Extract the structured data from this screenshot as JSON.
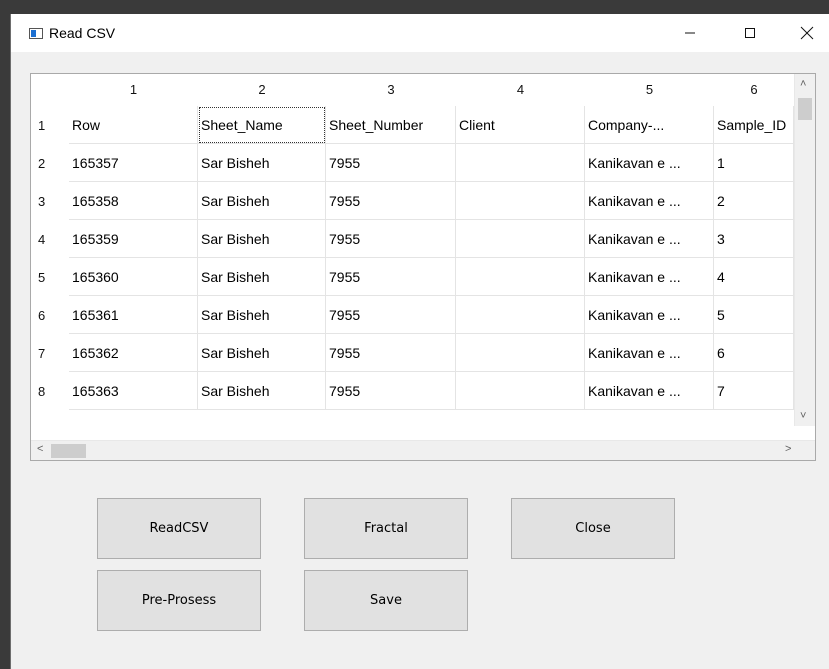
{
  "window": {
    "title": "Read CSV"
  },
  "table": {
    "column_headers": [
      "1",
      "2",
      "3",
      "4",
      "5",
      "6"
    ],
    "row_headers": [
      "1",
      "2",
      "3",
      "4",
      "5",
      "6",
      "7",
      "8"
    ],
    "rows": [
      [
        "Row",
        "Sheet_Name",
        "Sheet_Number",
        "Client",
        "Company-...",
        "Sample_ID"
      ],
      [
        "165357",
        "Sar Bisheh",
        "7955",
        "",
        "Kanikavan e ...",
        "1"
      ],
      [
        "165358",
        "Sar Bisheh",
        "7955",
        "",
        "Kanikavan e ...",
        "2"
      ],
      [
        "165359",
        "Sar Bisheh",
        "7955",
        "",
        "Kanikavan e ...",
        "3"
      ],
      [
        "165360",
        "Sar Bisheh",
        "7955",
        "",
        "Kanikavan e ...",
        "4"
      ],
      [
        "165361",
        "Sar Bisheh",
        "7955",
        "",
        "Kanikavan e ...",
        "5"
      ],
      [
        "165362",
        "Sar Bisheh",
        "7955",
        "",
        "Kanikavan e ...",
        "6"
      ],
      [
        "165363",
        "Sar Bisheh",
        "7955",
        "",
        "Kanikavan e ...",
        "7"
      ]
    ]
  },
  "buttons": {
    "read_csv": "ReadCSV",
    "fractal": "Fractal",
    "close": "Close",
    "pre_process": "Pre-Prosess",
    "save": "Save"
  },
  "icons": {
    "minimize": "minimize-icon",
    "maximize": "maximize-icon",
    "close": "close-icon"
  }
}
